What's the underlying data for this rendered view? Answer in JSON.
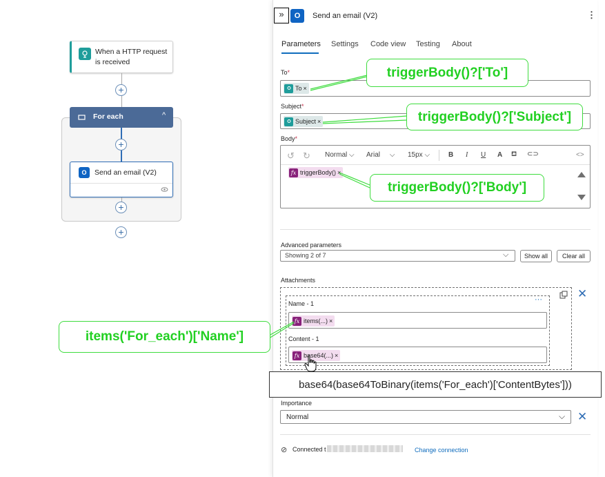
{
  "canvas": {
    "trigger_label": "When a HTTP request is received",
    "foreach_label": "For each",
    "action_label": "Send an email (V2)"
  },
  "panel": {
    "title": "Send an email (V2)",
    "tabs": [
      "Parameters",
      "Settings",
      "Code view",
      "Testing",
      "About"
    ],
    "to": {
      "label": "To",
      "token": "To"
    },
    "subject": {
      "label": "Subject",
      "token": "Subject"
    },
    "body": {
      "label": "Body",
      "toolbar": {
        "style": "Normal",
        "font": "Arial",
        "size": "15px"
      },
      "token": "triggerBody()"
    },
    "advanced": {
      "label": "Advanced parameters",
      "value": "Showing 2 of 7",
      "show_all": "Show all",
      "clear_all": "Clear all"
    },
    "attachments": {
      "label": "Attachments",
      "name_label": "Name - 1",
      "name_token": "items(...)",
      "content_label": "Content - 1",
      "content_token": "base64(...)"
    },
    "importance": {
      "label": "Importance",
      "value": "Normal"
    },
    "connection": {
      "prefix": "Connected t",
      "change": "Change connection"
    }
  },
  "callouts": {
    "to": "triggerBody()?['To']",
    "subject": "triggerBody()?['Subject']",
    "body": "triggerBody()?['Body']",
    "name": "items('For_each')['Name']",
    "tooltip": "base64(base64ToBinary(items('For_each')['ContentBytes']))"
  },
  "colors": {
    "accent": "#0f6cbd",
    "foreach": "#4b6a97",
    "callout": "#3ddc3d",
    "expression": "#88217a",
    "teal": "#1f9d9b"
  }
}
